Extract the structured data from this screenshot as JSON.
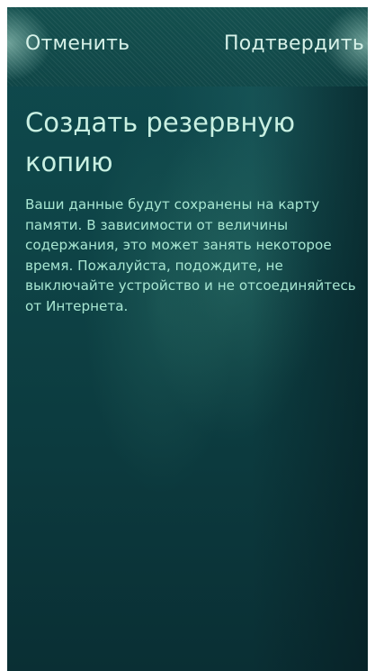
{
  "header": {
    "cancel_label": "Отменить",
    "confirm_label": "Подтвердить"
  },
  "page": {
    "title": "Создать резервную копию",
    "description": "Ваши данные будут сохранены на карту памяти. В зависимости от величины содержания, это может занять некоторое время. Пожалуйста, подождите, не выключайте устройство и не отсоединяйтесь от Интернета."
  },
  "colors": {
    "background": "#0e4447",
    "header_text": "#d6f1e8",
    "title_text": "#c9f0e2",
    "body_text": "#a8e6d2"
  }
}
